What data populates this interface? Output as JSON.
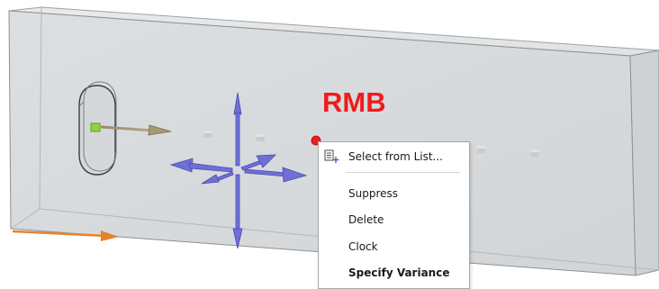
{
  "annotation": {
    "mouse_button": "RMB"
  },
  "context_menu": {
    "items": [
      {
        "label": "Select from List...",
        "icon": "select-list-icon",
        "bold": false
      },
      {
        "label": "Suppress",
        "bold": false
      },
      {
        "label": "Delete",
        "bold": false
      },
      {
        "label": "Clock",
        "bold": false
      },
      {
        "label": "Specify Variance",
        "bold": true
      }
    ]
  },
  "colors": {
    "annotation_red": "#ee1c1c",
    "triad_blue": "#6f6fd6",
    "body_fill": "#d7dadc",
    "axis_orange": "#e8822a",
    "selected_point_green": "#8fd63b"
  }
}
